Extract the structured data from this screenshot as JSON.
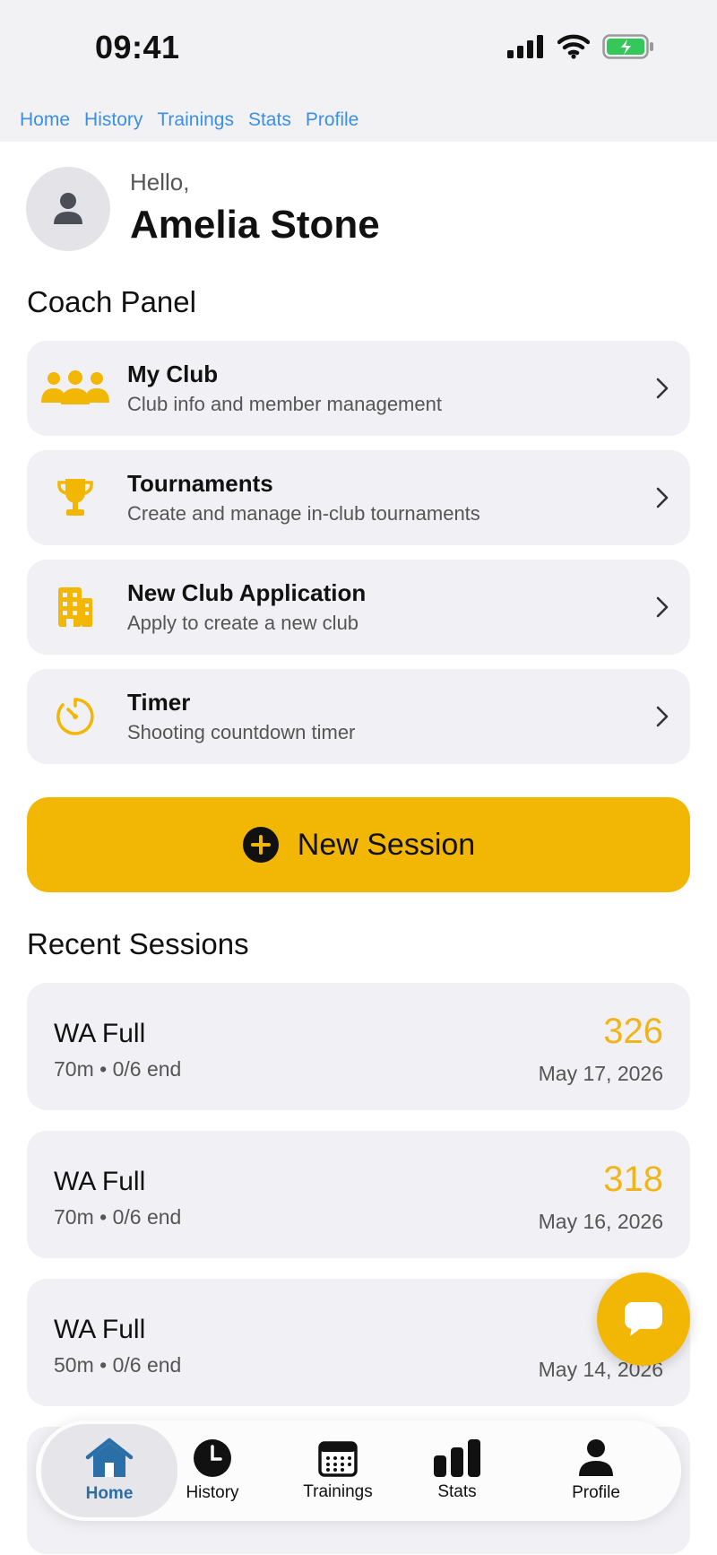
{
  "status_bar": {
    "time": "09:41"
  },
  "top_nav": [
    "Home",
    "History",
    "Trainings",
    "Stats",
    "Profile"
  ],
  "greeting": {
    "hello": "Hello,",
    "name": "Amelia Stone"
  },
  "coach_panel": {
    "title": "Coach Panel",
    "items": [
      {
        "title": "My Club",
        "subtitle": "Club info and member management",
        "icon": "group-icon"
      },
      {
        "title": "Tournaments",
        "subtitle": "Create and manage in-club tournaments",
        "icon": "trophy-icon"
      },
      {
        "title": "New Club Application",
        "subtitle": "Apply to create a new club",
        "icon": "building-icon"
      },
      {
        "title": "Timer",
        "subtitle": "Shooting countdown timer",
        "icon": "timer-icon"
      }
    ]
  },
  "new_session": {
    "label": "New Session"
  },
  "recent_sessions": {
    "title": "Recent Sessions",
    "items": [
      {
        "title": "WA Full",
        "subtitle": "70m • 0/6 end",
        "score": "326",
        "date": "May 17, 2026"
      },
      {
        "title": "WA Full",
        "subtitle": "70m • 0/6 end",
        "score": "318",
        "date": "May 16, 2026"
      },
      {
        "title": "WA Full",
        "subtitle": "50m • 0/6 end",
        "score": "",
        "date": "May 14, 2026"
      }
    ]
  },
  "tab_bar": [
    {
      "label": "Home",
      "icon": "home-icon",
      "active": true
    },
    {
      "label": "History",
      "icon": "clock-icon",
      "active": false
    },
    {
      "label": "Trainings",
      "icon": "calendar-icon",
      "active": false
    },
    {
      "label": "Stats",
      "icon": "bar-chart-icon",
      "active": false
    },
    {
      "label": "Profile",
      "icon": "person-icon",
      "active": false
    }
  ],
  "colors": {
    "accent": "#f2b705",
    "score": "#f0b51a",
    "link": "#3b8fe6",
    "active_tab": "#2a6fa8"
  }
}
